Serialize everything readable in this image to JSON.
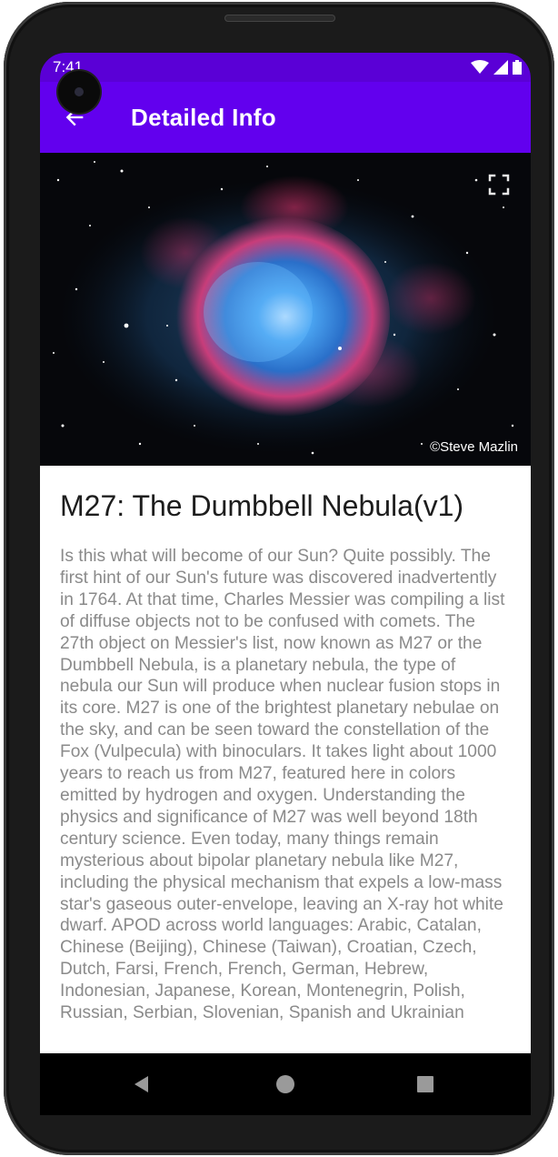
{
  "status_bar": {
    "time": "7:41",
    "icons": [
      "wifi-icon",
      "cellular-signal-icon",
      "battery-icon"
    ]
  },
  "app_bar": {
    "back_icon": "arrow-back-icon",
    "title": "Detailed Info",
    "background": "#6200ee"
  },
  "image": {
    "credit": "©Steve Mazlin",
    "fullscreen_icon": "fullscreen-icon"
  },
  "article": {
    "title": "M27: The Dumbbell Nebula(v1)",
    "body": "Is this what will become of our Sun? Quite possibly. The first hint of our Sun's future was discovered inadvertently in 1764. At that time, Charles Messier was compiling a list of diffuse objects not to be confused with comets. The 27th object on Messier's list, now known as M27 or the Dumbbell Nebula, is a planetary nebula, the type of nebula our Sun will produce when nuclear fusion stops in its core. M27 is one of the brightest planetary nebulae on the sky, and can be seen toward the constellation of the Fox (Vulpecula) with binoculars. It takes light about 1000 years to reach us from M27, featured here in colors emitted by hydrogen and oxygen. Understanding the physics and significance of M27 was well beyond 18th century science. Even today, many things remain mysterious about bipolar planetary nebula like M27, including the physical mechanism that expels a low-mass star's gaseous outer-envelope, leaving an X-ray hot white dwarf.   APOD across world languages: Arabic, Catalan, Chinese (Beijing), Chinese (Taiwan), Croatian, Czech, Dutch, Farsi, French, French, German, Hebrew, Indonesian, Japanese, Korean, Montenegrin, Polish, Russian, Serbian, Slovenian,  Spanish and Ukrainian"
  },
  "nav_bar": {
    "back_icon": "nav-back-triangle-icon",
    "home_icon": "nav-home-circle-icon",
    "recents_icon": "nav-recents-square-icon"
  }
}
